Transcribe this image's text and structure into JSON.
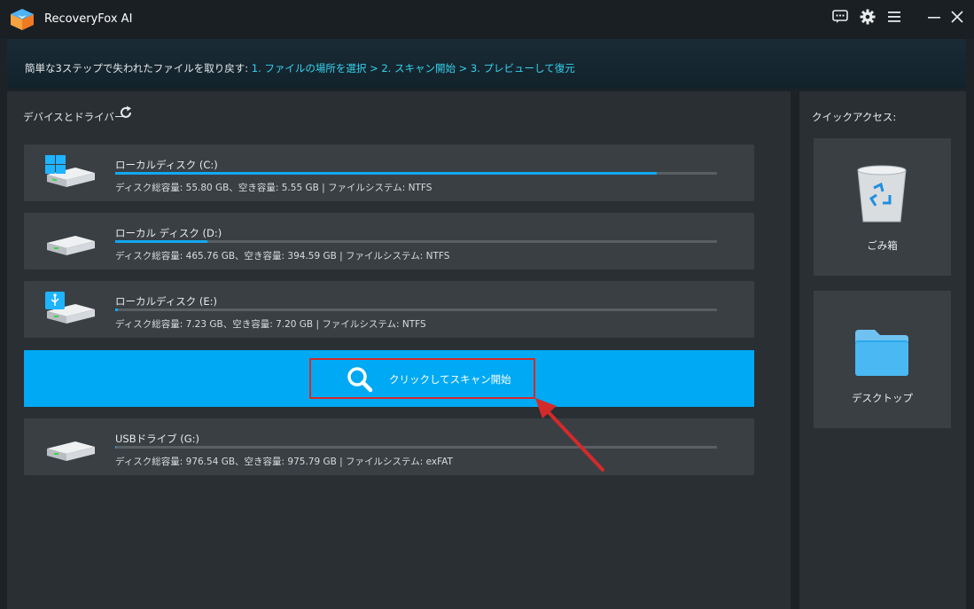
{
  "app": {
    "title": "RecoveryFox AI"
  },
  "guide": {
    "intro": "簡単な3ステップで失われたファイルを取り戻す: ",
    "steps": "1. ファイルの場所を選択 > 2. スキャン開始 > 3. プレビューして復元"
  },
  "devices": {
    "title": "デバイスとドライバー",
    "drives": [
      {
        "name": "ローカルディスク (C:)",
        "info": "ディスク総容量: 55.80 GB、空き容量: 5.55 GB | ファイルシステム: NTFS",
        "used": 0.9,
        "icon": "windows-drive-icon"
      },
      {
        "name": "ローカル ディスク (D:)",
        "info": "ディスク総容量: 465.76 GB、空き容量: 394.59 GB | ファイルシステム: NTFS",
        "used": 0.153,
        "icon": "hard-drive-icon"
      },
      {
        "name": "ローカルディスク (E:)",
        "info": "ディスク総容量: 7.23 GB、空き容量: 7.20 GB | ファイルシステム: NTFS",
        "used": 0.004,
        "icon": "usb-drive-icon"
      }
    ],
    "usb_drive": {
      "name": "USBドライブ (G:)",
      "info": "ディスク総容量: 976.54 GB、空き容量: 975.79 GB | ファイルシステム: exFAT",
      "used": 0.001,
      "icon": "hard-drive-icon"
    }
  },
  "scan": {
    "label": "クリックしてスキャン開始"
  },
  "quick_access": {
    "title": "クイックアクセス:",
    "items": [
      {
        "label": "ごみ箱",
        "icon": "recycle-bin-icon"
      },
      {
        "label": "デスクトップ",
        "icon": "folder-icon"
      }
    ]
  },
  "colors": {
    "accent": "#00a9f3",
    "highlight": "#d42a2a",
    "steps_text": "#35d3ef"
  }
}
